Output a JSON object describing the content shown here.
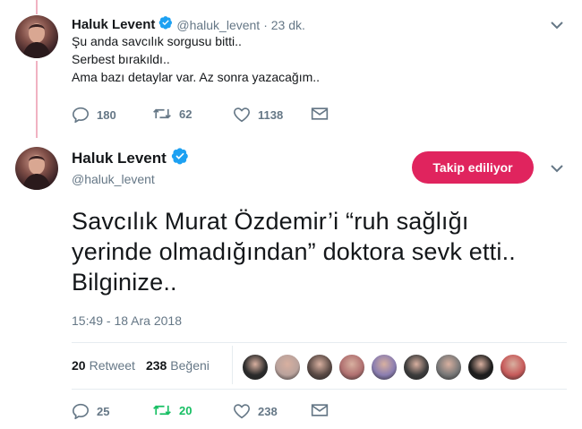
{
  "tweet1": {
    "name": "Haluk Levent",
    "handle": "@haluk_levent",
    "time": "· 23 dk.",
    "lines": [
      "Şu anda savcılık sorgusu bitti..",
      "Serbest bırakıldı..",
      "Ama bazı detaylar var. Az sonra yazacağım.."
    ],
    "replies": "180",
    "retweets": "62",
    "likes": "1138"
  },
  "tweet2": {
    "name": "Haluk Levent",
    "handle": "@haluk_levent",
    "follow_label": "Takip ediliyor",
    "lines": [
      "Savcılık Murat Özdemir’i “ruh sağlığı",
      "yerinde olmadığından” doktora sevk etti..",
      "Bilginize.."
    ],
    "timestamp": "15:49 - 18 Ara 2018",
    "retweet_count": "20",
    "retweet_label": "Retweet",
    "like_count": "238",
    "like_label": "Beğeni",
    "replies": "25",
    "retweets": "20",
    "likes": "238"
  },
  "colors": {
    "accent": "#e0245e",
    "verified": "#1da1f2",
    "retweeted": "#17bf63",
    "muted": "#657786"
  },
  "liker_faces": [
    "#2b2b2b",
    "#b9a29c",
    "#5a4a45",
    "#b07070",
    "#8a7db0",
    "#3c3c3c",
    "#777777",
    "#1c1c1c",
    "#c65a5a"
  ]
}
